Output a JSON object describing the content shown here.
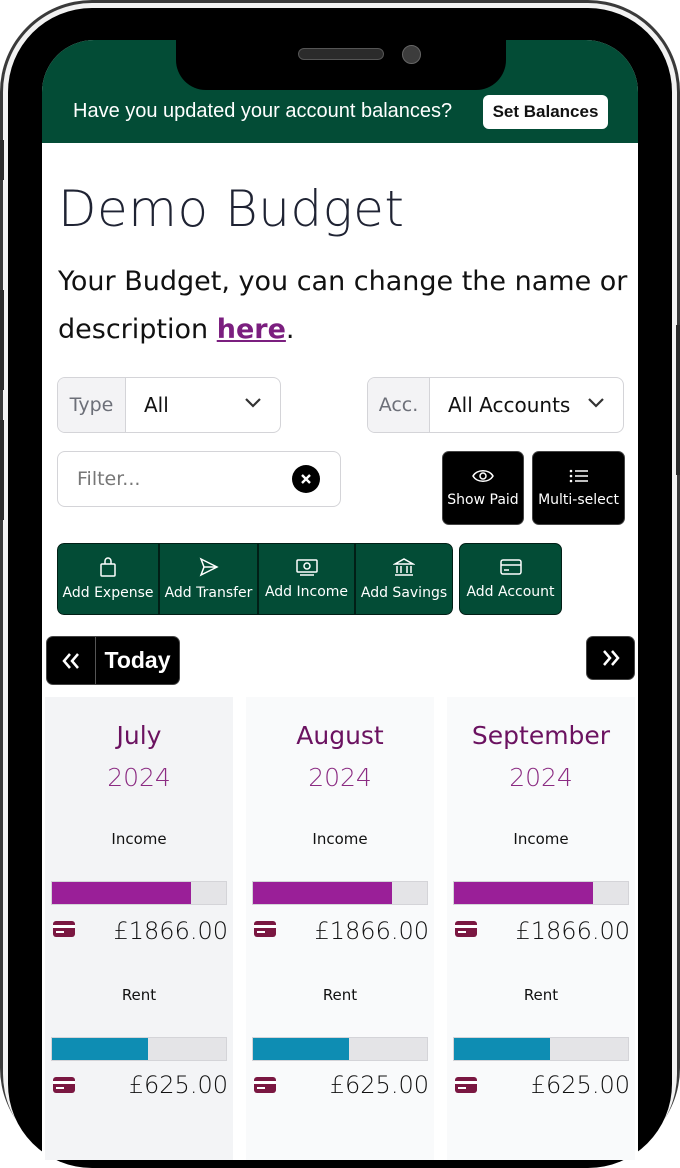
{
  "banner": {
    "message": "Have you updated your account balances?",
    "button_label": "Set Balances"
  },
  "page": {
    "title": "Demo Budget",
    "description_before": "Your Budget, you can change the name or description ",
    "description_link": "here",
    "description_after": "."
  },
  "filters": {
    "type_label": "Type",
    "type_value": "All",
    "account_label": "Acc.",
    "account_value": "All Accounts",
    "filter_placeholder": "Filter..."
  },
  "toggles": {
    "show_paid": "Show Paid",
    "multi_select": "Multi-select"
  },
  "actions": {
    "add_expense": "Add Expense",
    "add_transfer": "Add Transfer",
    "add_income": "Add Income",
    "add_savings": "Add Savings",
    "add_account": "Add Account"
  },
  "navigation": {
    "today": "Today",
    "prev_icon": "double-chevron-left-icon",
    "next_icon": "double-chevron-right-icon"
  },
  "colors": {
    "brand_green": "#034c36",
    "income_bar": "#9a1f98",
    "rent_bar": "#0e8db3",
    "month_text": "#6b1260",
    "card_icon": "#7a1741"
  },
  "months": [
    {
      "name": "July",
      "year": "2024",
      "items": [
        {
          "label": "Income",
          "amount": "£1866.00",
          "progress": 0.8
        },
        {
          "label": "Rent",
          "amount": "£625.00",
          "progress": 0.55
        }
      ]
    },
    {
      "name": "August",
      "year": "2024",
      "items": [
        {
          "label": "Income",
          "amount": "£1866.00",
          "progress": 0.8
        },
        {
          "label": "Rent",
          "amount": "£625.00",
          "progress": 0.55
        }
      ]
    },
    {
      "name": "September",
      "year": "2024",
      "items": [
        {
          "label": "Income",
          "amount": "£1866.00",
          "progress": 0.8
        },
        {
          "label": "Rent",
          "amount": "£625.00",
          "progress": 0.55
        }
      ]
    }
  ]
}
